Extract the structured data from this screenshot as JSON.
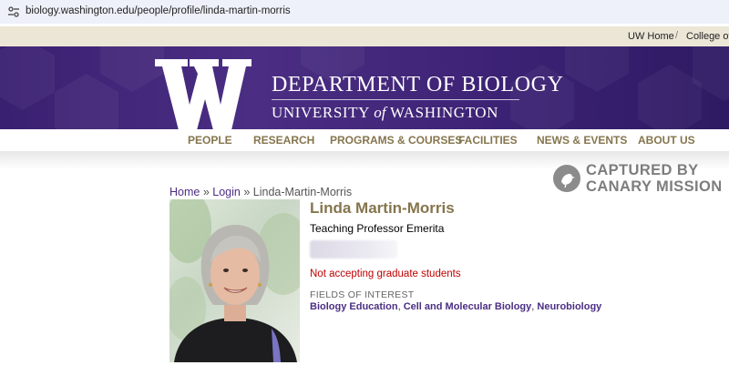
{
  "browser": {
    "url": "biology.washington.edu/people/profile/linda-martin-morris"
  },
  "topbar": {
    "links": [
      "UW Home",
      "College of A"
    ],
    "separator": "/"
  },
  "banner": {
    "department": "DEPARTMENT OF BIOLOGY",
    "university_prefix": "UNIVERSITY",
    "university_of": "of",
    "university_suffix": "WASHINGTON",
    "brand_color": "#4b2e83",
    "gold_color": "#85754d"
  },
  "nav": {
    "items": [
      "PEOPLE",
      "RESEARCH",
      "PROGRAMS & COURSES",
      "FACILITIES",
      "NEWS & EVENTS",
      "ABOUT US"
    ]
  },
  "watermark": {
    "line1": "CAPTURED BY",
    "line2": "CANARY MISSION"
  },
  "breadcrumb": {
    "home": "Home",
    "sep": "»",
    "login": "Login",
    "current": "Linda-Martin-Morris"
  },
  "profile": {
    "name": "Linda Martin-Morris",
    "title": "Teaching Professor Emerita",
    "status": "Not accepting graduate students",
    "fields_label": "FIELDS OF INTEREST",
    "fields": [
      "Biology Education",
      "Cell and Molecular Biology",
      "Neurobiology"
    ],
    "fields_sep": ","
  }
}
